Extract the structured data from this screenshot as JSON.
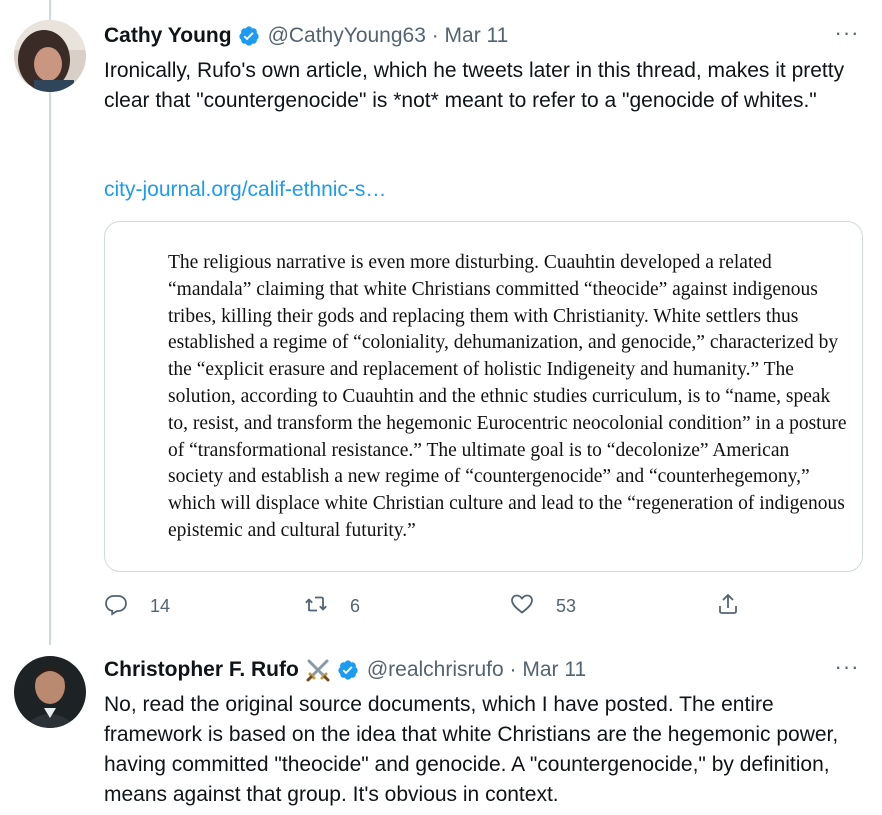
{
  "tweets": [
    {
      "name": "Cathy Young",
      "handle_date": "@CathyYoung63 · Mar 11",
      "text": "Ironically, Rufo's own article, which he tweets later in this thread, makes it pretty clear that \"countergenocide\" is *not* meant to refer to a \"genocide of whites.\"",
      "link": "city-journal.org/calif-ethnic-s…",
      "image_text": "The religious narrative is even more disturbing. Cuauhtin developed a related “mandala” claiming that white Christians committed “theocide” against indigenous tribes, killing their gods and replacing them with Christianity. White settlers thus established a regime of “coloniality, dehumanization, and genocide,” characterized by the “explicit erasure and replacement of holistic Indigeneity and humanity.” The solution, according to Cuauhtin and the ethnic studies curriculum, is to “name, speak to, resist, and transform the hegemonic Eurocentric neocolonial condition” in a posture of “transformational resistance.” The ultimate goal is to “decolonize” American society and establish a new regime of “countergenocide” and “counterhegemony,” which will displace white Christian culture and lead to the “regeneration of indigenous epistemic and cultural futurity.”",
      "replies": "14",
      "retweets": "6",
      "likes": "53",
      "more": "···"
    },
    {
      "name": "Christopher F. Rufo",
      "handle_date": "@realchrisrufo · Mar 11",
      "text": "No, read the original source documents, which I have posted. The entire framework is based on the idea that white Christians are the hegemonic power, having committed \"theocide\" and genocide. A \"countergenocide,\" by definition, means against that group. It's obvious in context.",
      "more": "···"
    }
  ],
  "colors": {
    "verified": "#1d9bf0",
    "link": "#1d9bf0",
    "secondary": "#536471",
    "border": "#cfd9de"
  },
  "icons": [
    "verified-badge-icon",
    "crossed-swords-icon",
    "reply-icon",
    "retweet-icon",
    "like-icon",
    "share-icon",
    "more-icon"
  ]
}
